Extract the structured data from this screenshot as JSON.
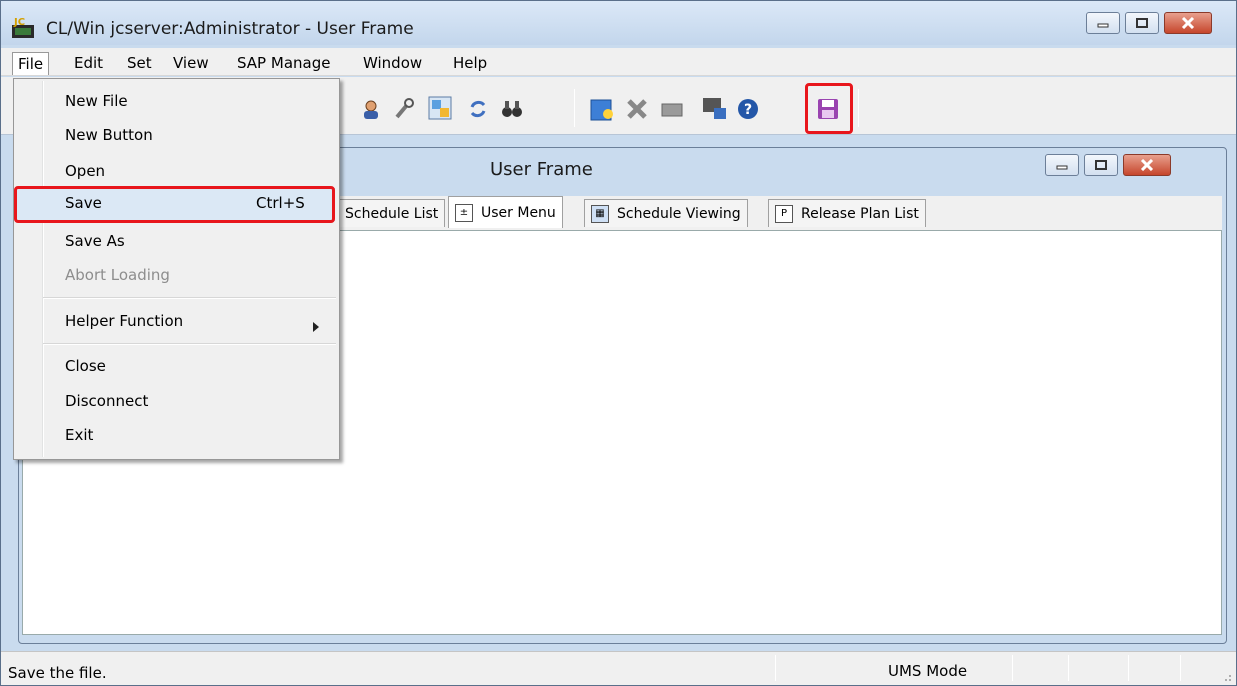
{
  "window": {
    "title": "CL/Win jcserver:Administrator - User Frame",
    "app_icon_text": "JC"
  },
  "menubar": [
    "File",
    "Edit",
    "Set",
    "View",
    "SAP Manage",
    "Window",
    "Help"
  ],
  "file_menu": {
    "items": [
      {
        "label": "New File"
      },
      {
        "label": "New Button"
      },
      {
        "label": "Open"
      },
      {
        "label": "Save",
        "shortcut": "Ctrl+S",
        "highlighted": true
      },
      {
        "label": "Save As"
      },
      {
        "label": "Abort Loading",
        "disabled": true
      },
      {
        "label": "Helper Function",
        "submenu": true
      },
      {
        "label": "Close"
      },
      {
        "label": "Disconnect"
      },
      {
        "label": "Exit"
      }
    ]
  },
  "child_window": {
    "title": "User Frame"
  },
  "tabs": [
    {
      "label": "Schedule List"
    },
    {
      "label": "User Menu",
      "active": true
    },
    {
      "label": "Schedule Viewing"
    },
    {
      "label": "Release Plan List"
    }
  ],
  "toolbar_icons": [
    "user-icon",
    "tools-icon",
    "layout-icon",
    "refresh-icon",
    "binoculars-icon",
    "new-item-icon",
    "delete-icon",
    "blank-icon",
    "job-icon",
    "help-icon",
    "save-icon"
  ],
  "status": {
    "message": "Save the file.",
    "mode": "UMS Mode"
  },
  "colors": {
    "highlight_box": "#e8161c",
    "frame_bg": "#c9dbee"
  }
}
